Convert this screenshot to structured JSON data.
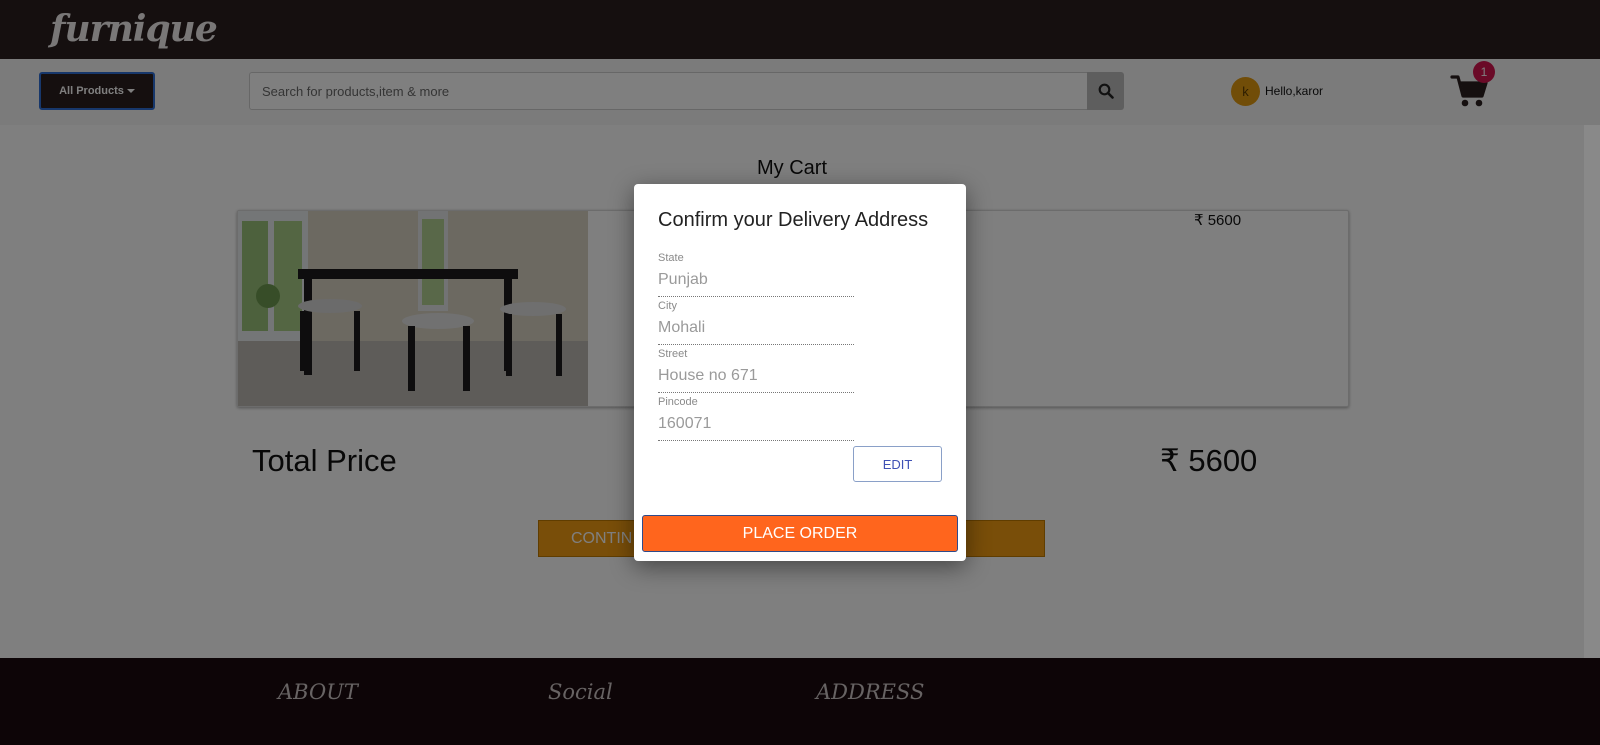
{
  "header": {
    "logo": "furnique",
    "all_products_label": "All Products",
    "search_placeholder": "Search for products,item & more",
    "user_initial": "k",
    "user_greeting": "Hello,karor",
    "cart_count": "1"
  },
  "cart": {
    "title": "My Cart",
    "item_price": "₹ 5600",
    "total_label": "Total Price",
    "total_value": "₹ 5600",
    "continue_label": "CONTIN"
  },
  "footer": {
    "headings": [
      "ABOUT",
      "Social",
      "ADDRESS"
    ]
  },
  "modal": {
    "title": "Confirm your Delivery Address",
    "fields": [
      {
        "label": "State",
        "value": "Punjab"
      },
      {
        "label": "City",
        "value": "Mohali"
      },
      {
        "label": "Street",
        "value": "House no 671"
      },
      {
        "label": "Pincode",
        "value": "160071"
      }
    ],
    "edit_label": "EDIT",
    "place_order_label": "PLACE ORDER"
  },
  "colors": {
    "header_bg": "#2b1f1f",
    "accent_orange": "#ff651d",
    "continue_orange": "#f39c12",
    "badge": "#d4144f",
    "avatar": "#e39a11",
    "footer_bg": "#1a0b0e"
  }
}
